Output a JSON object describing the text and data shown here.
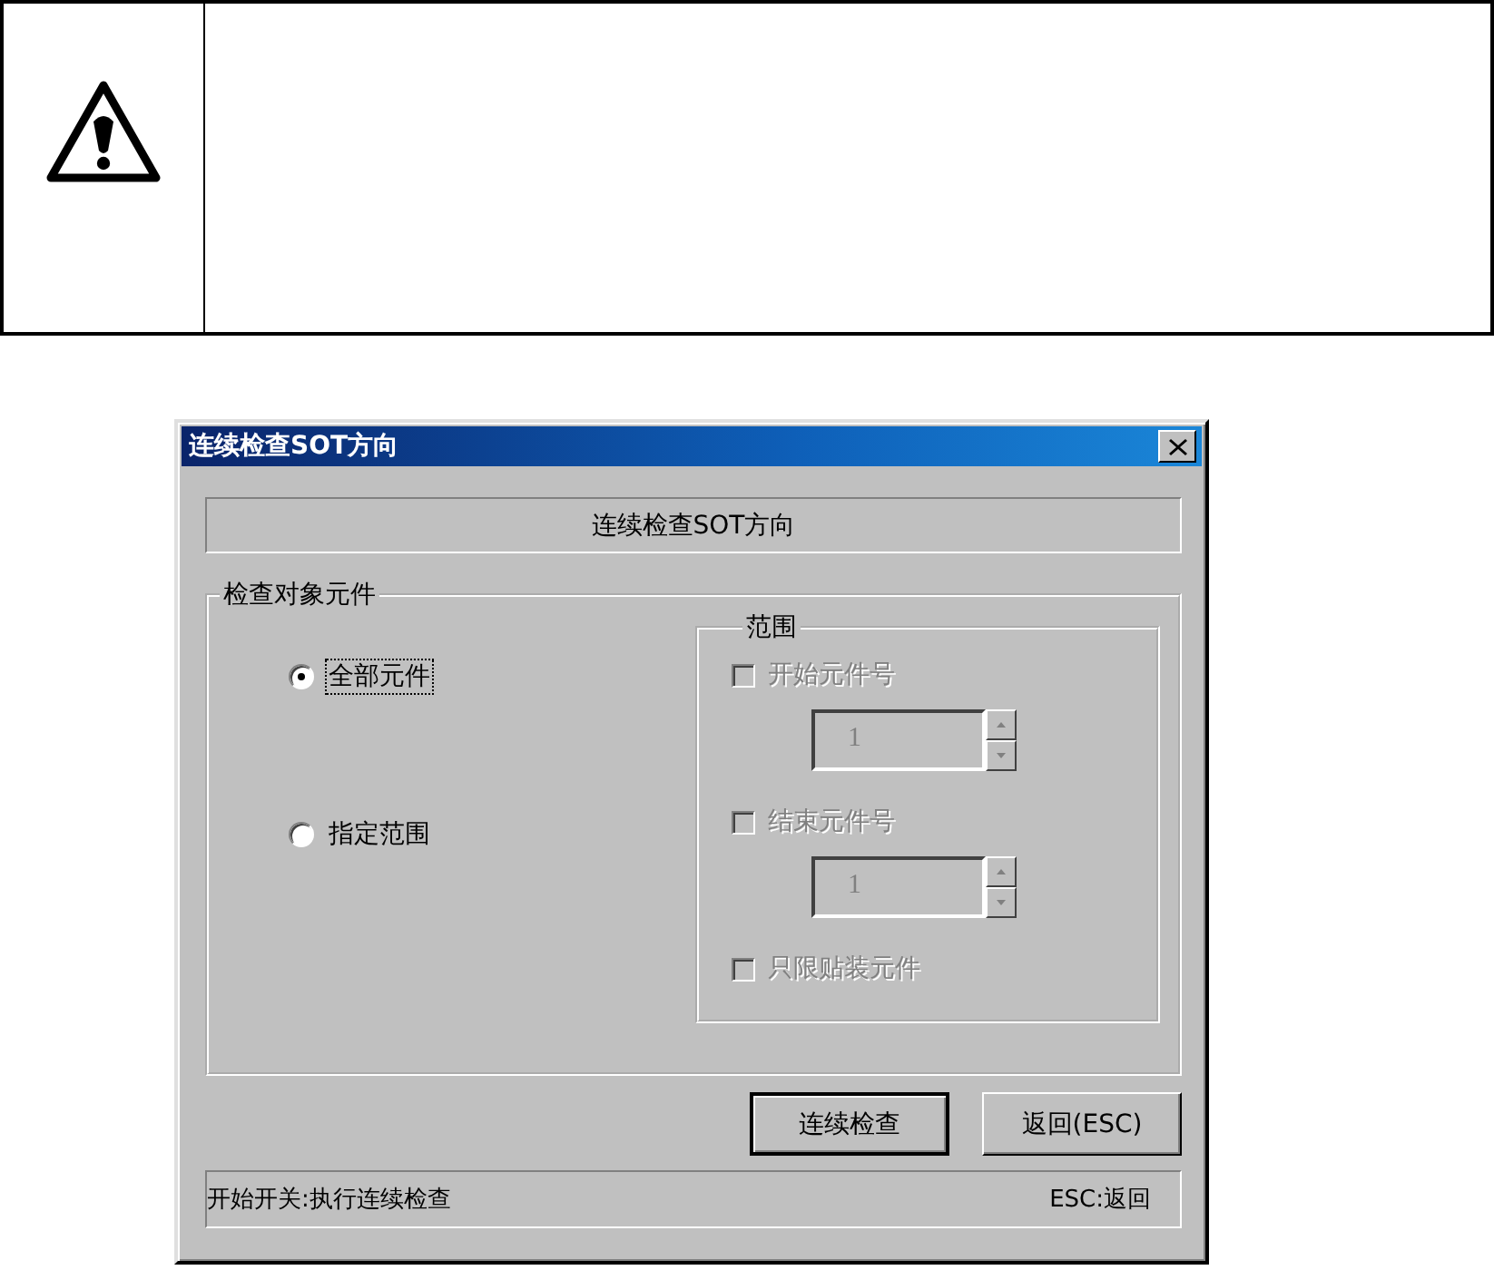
{
  "notice": {
    "kind": "warning"
  },
  "dialog": {
    "title": "连续检查SOT方向",
    "header": "连续检查SOT方向",
    "group": {
      "title": "检查对象元件",
      "options": [
        {
          "label": "全部元件",
          "selected": true,
          "focused": true
        },
        {
          "label": "指定范围",
          "selected": false,
          "focused": false
        }
      ],
      "range": {
        "title": "范围",
        "items": [
          {
            "kind": "checkbox",
            "label": "开始元件号",
            "checked": false,
            "disabled": true
          },
          {
            "kind": "spin",
            "value": "1",
            "disabled": true
          },
          {
            "kind": "checkbox",
            "label": "结束元件号",
            "checked": false,
            "disabled": true
          },
          {
            "kind": "spin",
            "value": "1",
            "disabled": true
          },
          {
            "kind": "checkbox",
            "label": "只限贴装元件",
            "checked": false,
            "disabled": true
          }
        ]
      }
    },
    "buttons": [
      {
        "label": "连续检查",
        "default": true
      },
      {
        "label": "返回(ESC)",
        "default": false
      }
    ],
    "status_bar": {
      "left": "开始开关:执行连续检查",
      "right": "ESC:返回"
    }
  }
}
